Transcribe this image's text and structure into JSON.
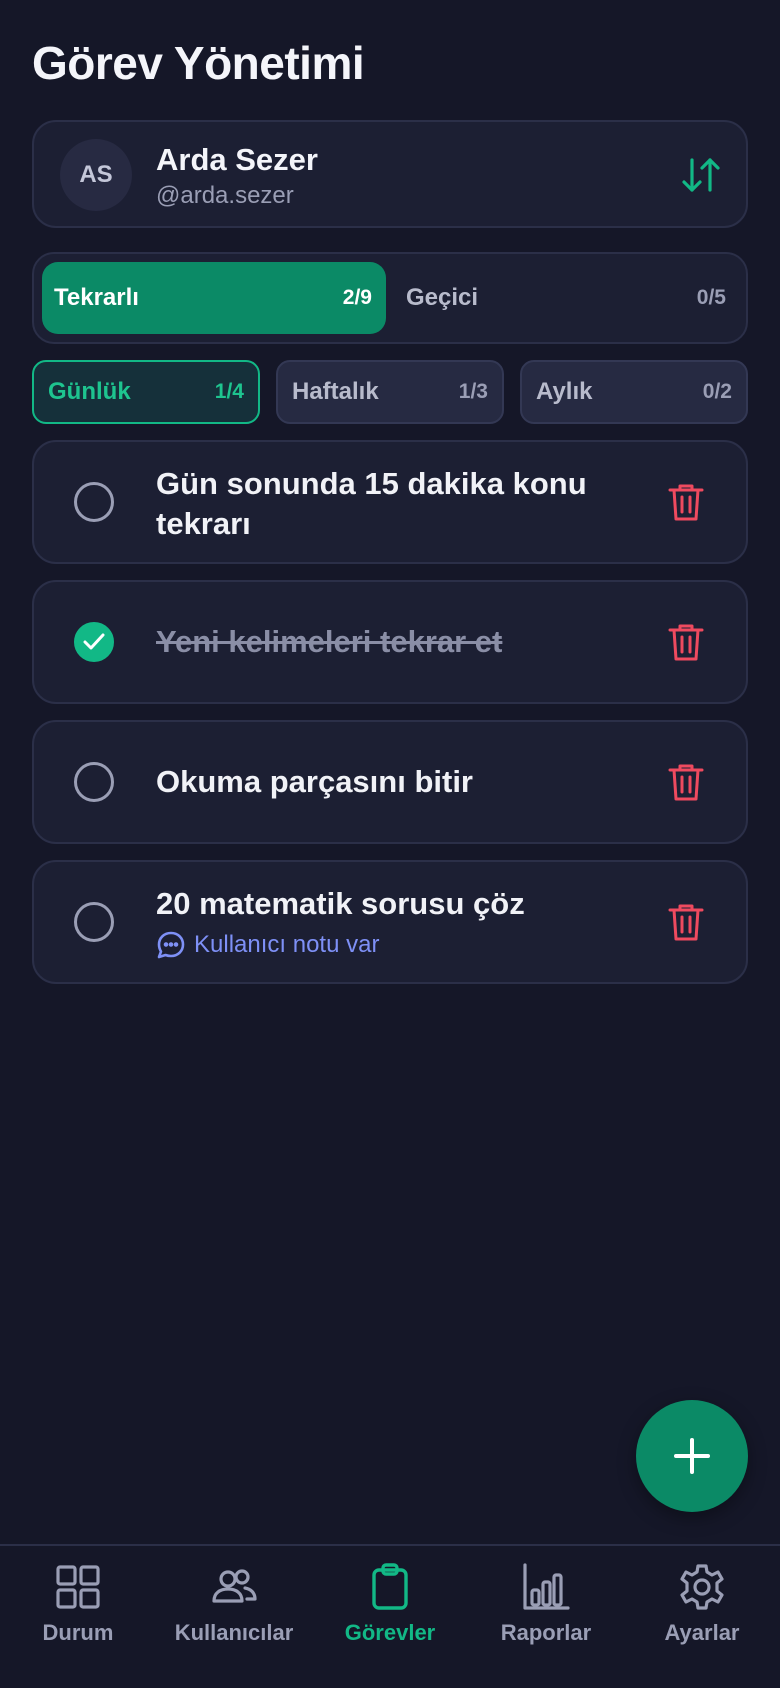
{
  "header": {
    "title": "Görev Yönetimi"
  },
  "user": {
    "initials": "AS",
    "name": "Arda Sezer",
    "handle": "@arda.sezer"
  },
  "type_tabs": [
    {
      "label": "Tekrarlı",
      "count": "2/9",
      "active": true
    },
    {
      "label": "Geçici",
      "count": "0/5",
      "active": false
    }
  ],
  "period_chips": [
    {
      "label": "Günlük",
      "count": "1/4",
      "active": true
    },
    {
      "label": "Haftalık",
      "count": "1/3",
      "active": false
    },
    {
      "label": "Aylık",
      "count": "0/2",
      "active": false
    }
  ],
  "tasks": [
    {
      "title": "Gün sonunda 15 dakika konu tekrarı",
      "done": false
    },
    {
      "title": "Yeni kelimeleri tekrar et",
      "done": true
    },
    {
      "title": "Okuma parçasını bitir",
      "done": false
    },
    {
      "title": "20 matematik sorusu çöz",
      "done": false,
      "note": "Kullanıcı notu var"
    }
  ],
  "nav": [
    {
      "label": "Durum",
      "icon": "grid-icon",
      "active": false
    },
    {
      "label": "Kullanıcılar",
      "icon": "users-icon",
      "active": false
    },
    {
      "label": "Görevler",
      "icon": "clipboard-icon",
      "active": true
    },
    {
      "label": "Raporlar",
      "icon": "bar-chart-icon",
      "active": false
    },
    {
      "label": "Ayarlar",
      "icon": "gear-icon",
      "active": false
    }
  ],
  "colors": {
    "background": "#151728",
    "card": "#1c1f33",
    "accent": "#12b886",
    "accent_dark": "#0b8a66",
    "danger": "#ef4a5f",
    "note": "#7e90f6"
  }
}
